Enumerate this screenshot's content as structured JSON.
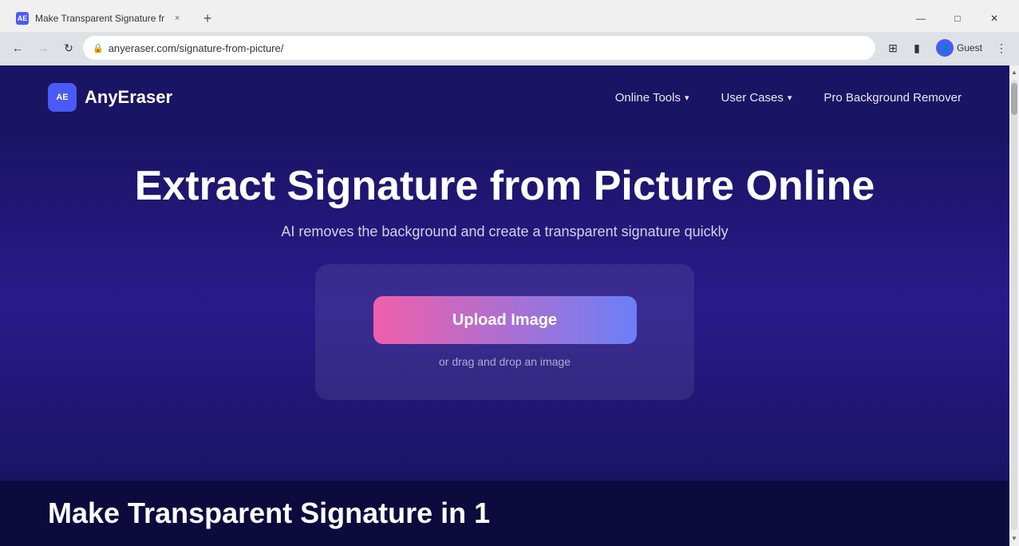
{
  "browser": {
    "tab": {
      "favicon": "AE",
      "title": "Make Transparent Signature fr",
      "close_label": "×"
    },
    "new_tab_label": "+",
    "window_controls": {
      "minimize": "—",
      "maximize": "□",
      "close": "✕"
    },
    "address_bar": {
      "url": "anyeraser.com/signature-from-picture/",
      "lock_icon": "🔒",
      "back_disabled": false,
      "forward_disabled": true
    },
    "profile": {
      "label": "Guest"
    }
  },
  "site": {
    "nav": {
      "logo_icon": "AE",
      "logo_text": "AnyEraser",
      "links": [
        {
          "label": "Online Tools",
          "has_chevron": true
        },
        {
          "label": "User Cases",
          "has_chevron": true
        },
        {
          "label": "Pro Background Remover",
          "has_chevron": false
        }
      ]
    },
    "hero": {
      "title": "Extract Signature from Picture Online",
      "subtitle": "AI removes the background and create a transparent signature quickly",
      "upload_button": "Upload Image",
      "drag_drop_text": "or drag and drop an image"
    },
    "bottom": {
      "title": "Make Transparent Signature in 1"
    }
  }
}
